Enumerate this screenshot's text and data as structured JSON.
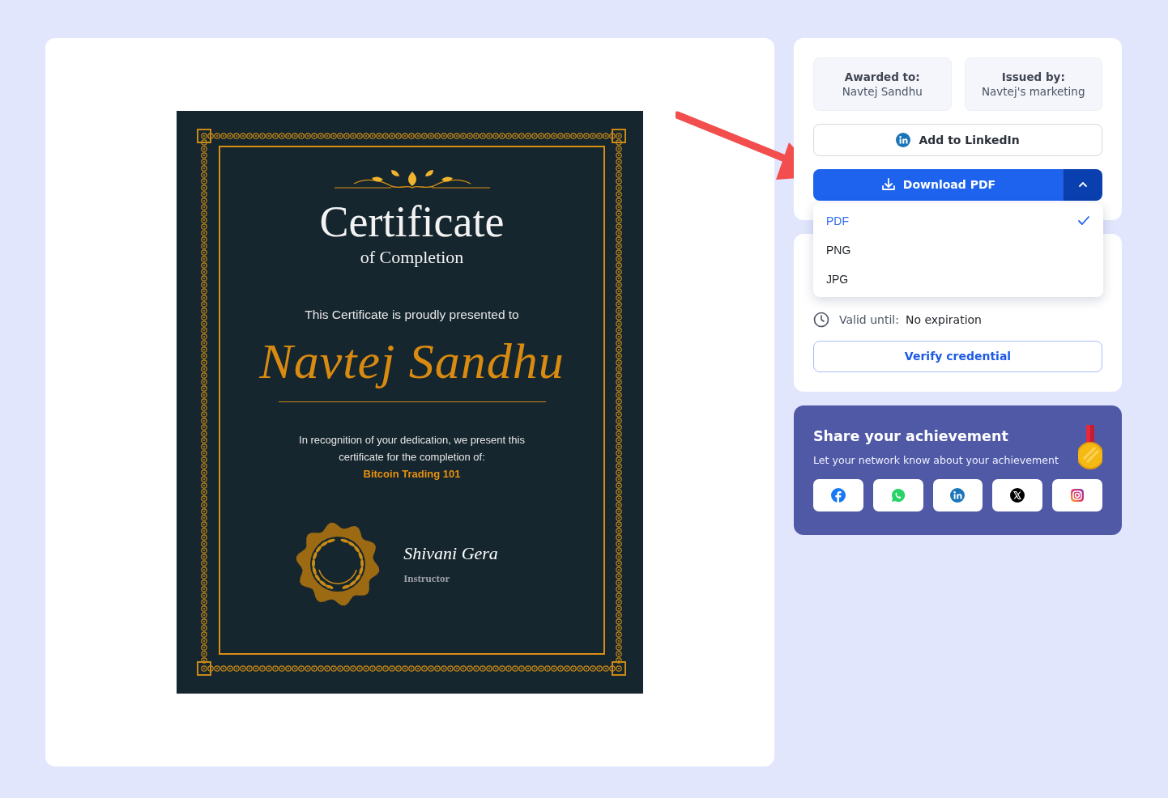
{
  "certificate": {
    "title": "Certificate",
    "subtitle": "of Completion",
    "presented_to": "This Certificate is proudly presented to",
    "recipient": "Navtej Sandhu",
    "recognition": "In recognition of your dedication, we present this certificate for the completion of:",
    "course": "Bitcoin Trading 101",
    "signatory": {
      "name": "Shivani Gera",
      "role": "Instructor"
    }
  },
  "details": [
    {
      "label": "Awarded to:",
      "value": "Navtej Sandhu"
    },
    {
      "label": "Issued by:",
      "value": "Navtej's marketing"
    }
  ],
  "linkedin_button": "Add to LinkedIn",
  "download": {
    "label": "Download PDF",
    "expanded": true
  },
  "formats": [
    {
      "label": "PDF",
      "selected": true
    },
    {
      "label": "PNG",
      "selected": false
    },
    {
      "label": "JPG",
      "selected": false
    }
  ],
  "validity": {
    "label": "Valid until:",
    "value": "No expiration"
  },
  "verify_button": "Verify credential",
  "share": {
    "title": "Share your achievement",
    "subtitle": "Let your network know about your achievement",
    "networks": [
      {
        "kind": "facebook"
      },
      {
        "kind": "whatsapp"
      },
      {
        "kind": "linkedin"
      },
      {
        "kind": "x"
      },
      {
        "kind": "instagram"
      }
    ]
  }
}
